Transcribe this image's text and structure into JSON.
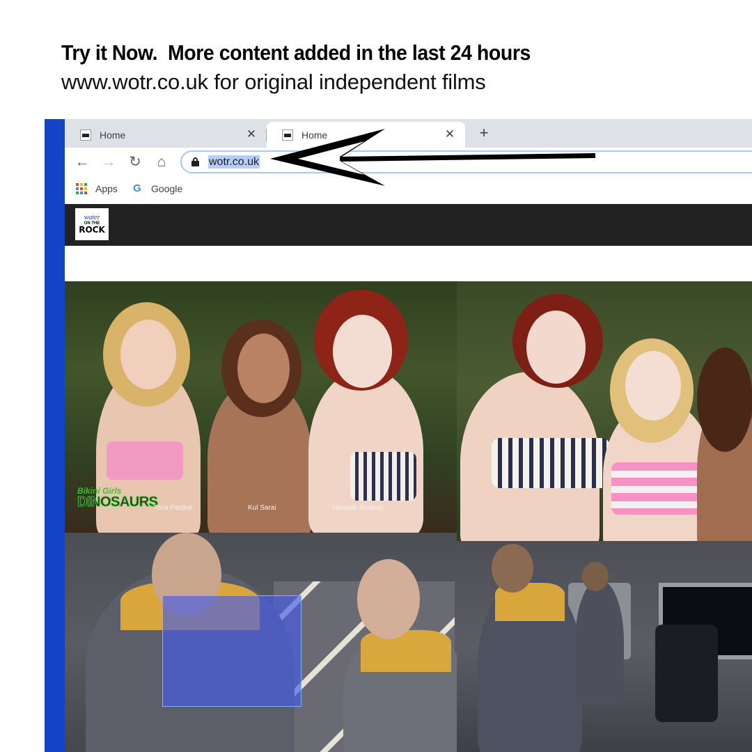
{
  "ad": {
    "headline": "Try it Now.  More content added in the last 24 hours",
    "subline": "www.wotr.co.uk for original independent films"
  },
  "browser": {
    "tabs": [
      {
        "title": "Home",
        "active": false
      },
      {
        "title": "Home",
        "active": true
      }
    ],
    "tab_close_glyph": "✕",
    "new_tab_glyph": "+",
    "nav": {
      "back": "←",
      "forward": "→",
      "reload": "↻",
      "home": "⌂"
    },
    "address": {
      "url": "wotr.co.uk",
      "selected": true
    },
    "bookmarks": [
      {
        "label": "Apps",
        "icon": "apps-grid-icon"
      },
      {
        "label": "Google",
        "icon": "google-g-icon"
      }
    ]
  },
  "site": {
    "logo": {
      "line1": "water",
      "line2": "ON THE",
      "line3": "ROCK"
    },
    "header_color": "#222222"
  },
  "photos": {
    "still1": {
      "film_logo": {
        "line1": "Bikini Girls",
        "line2": "DINOSAURS"
      },
      "credits": [
        "Toria Pardoe",
        "Kul Sarai",
        "Hannah Rosbon"
      ]
    }
  },
  "colors": {
    "accent_bar": "#1444c6",
    "address_highlight": "#b4cdfb",
    "arrow": "#000000"
  }
}
